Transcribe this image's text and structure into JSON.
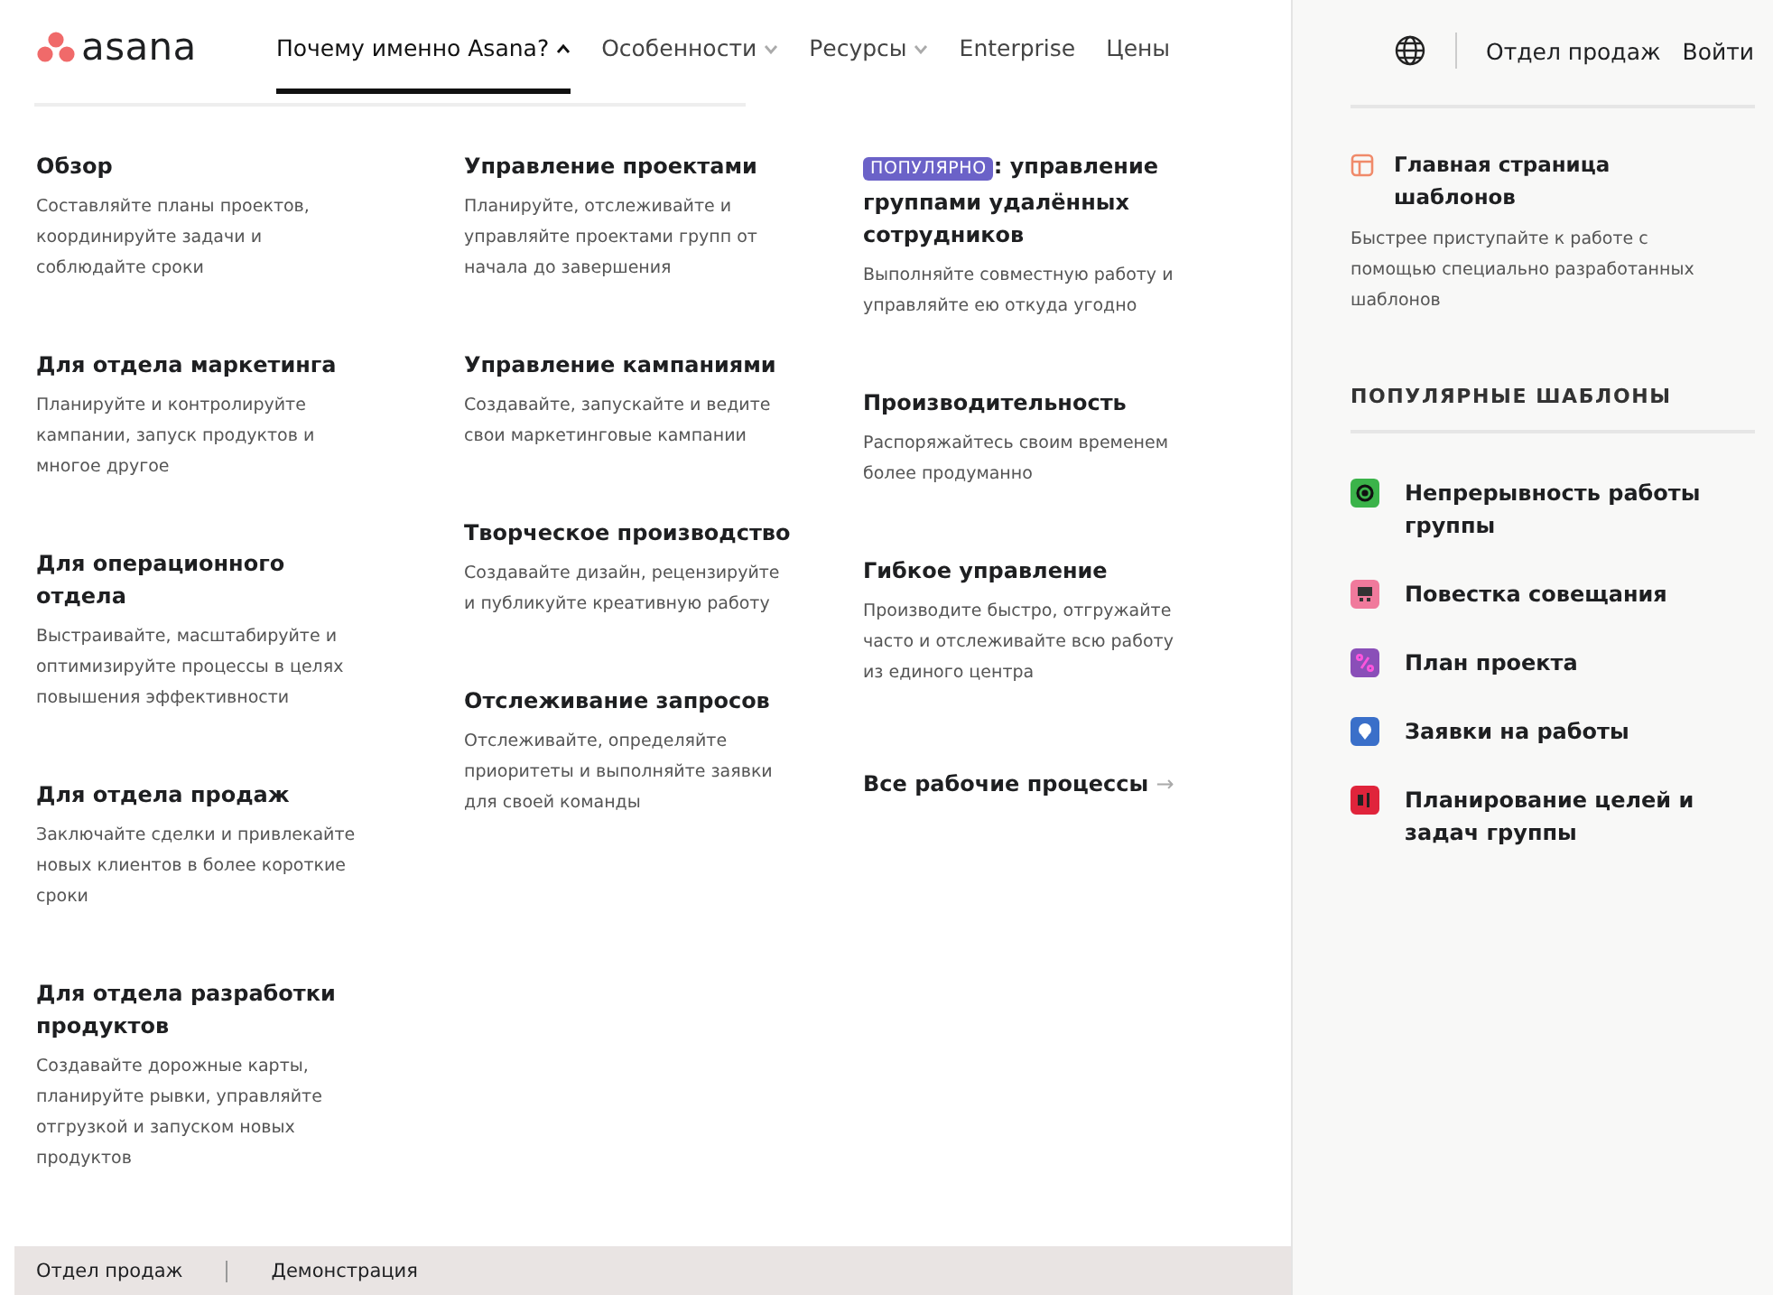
{
  "logo": {
    "text": "asana"
  },
  "nav": [
    {
      "label": "Почему именно Asana?",
      "dropdown": true,
      "expanded": true,
      "selected": true
    },
    {
      "label": "Особенности",
      "dropdown": true,
      "expanded": false,
      "selected": false
    },
    {
      "label": "Ресурсы",
      "dropdown": true,
      "expanded": false,
      "selected": false
    },
    {
      "label": "Enterprise",
      "dropdown": false,
      "selected": false
    },
    {
      "label": "Цены",
      "dropdown": false,
      "selected": false
    }
  ],
  "header_right": {
    "sales": "Отдел продаж",
    "login": "Войти"
  },
  "columns": [
    {
      "items": [
        {
          "title": "Обзор",
          "description": "Составляйте планы проектов, координируйте задачи и соблюдайте сроки"
        },
        {
          "title": "Для отдела маркетинга",
          "description": "Планируйте и контролируйте кампании, запуск продуктов и многое другое"
        },
        {
          "title": "Для операционного отдела",
          "description": "Выстраивайте, масштабируйте и оптимизируйте процессы в целях повышения эффективности"
        },
        {
          "title": "Для отдела продаж",
          "description": "Заключайте сделки и привлекайте новых клиентов в более короткие сроки"
        },
        {
          "title": "Для отдела разработки продуктов",
          "description": "Создавайте дорожные карты, планируйте рывки, управляйте отгрузкой и запуском новых продуктов"
        }
      ]
    },
    {
      "items": [
        {
          "title": "Управление проектами",
          "description": "Планируйте, отслеживайте и управляйте проектами групп от начала до завершения"
        },
        {
          "title": "Управление кампаниями",
          "description": "Создавайте, запускайте и ведите свои маркетинговые кампании"
        },
        {
          "title": "Творческое производство",
          "description": "Создавайте дизайн, рецензируйте и публикуйте креативную работу"
        },
        {
          "title": "Отслеживание запросов",
          "description": "Отслеживайте, определяйте приоритеты и выполняйте заявки для своей команды"
        }
      ]
    },
    {
      "items": [
        {
          "badge": "ПОПУЛЯРНО",
          "title": ": управление группами удалённых сотрудников",
          "description": "Выполняйте совместную работу и управляйте ею откуда угодно"
        },
        {
          "title": "Производительность",
          "description": "Распоряжайтесь своим временем более продуманно"
        },
        {
          "title": "Гибкое управление",
          "description": "Производите быстро, отгружайте часто и отслеживайте всю работу из единого центра"
        }
      ],
      "link": {
        "label": "Все рабочие процессы",
        "arrow": "→"
      }
    }
  ],
  "templates_home": {
    "title": "Главная страница шаблонов",
    "description": "Быстрее приступайте к работе с помощью специально разработанных шаблонов"
  },
  "popular_templates": {
    "heading": "ПОПУЛЯРНЫЕ ШАБЛОНЫ",
    "items": [
      {
        "name": "Непрерывность работы группы",
        "color": "#3bb34a",
        "kind": "target"
      },
      {
        "name": "Повестка совещания",
        "color": "#f07a9c",
        "kind": "board"
      },
      {
        "name": "План проекта",
        "color": "#8a4fb8",
        "kind": "path"
      },
      {
        "name": "Заявки на работы",
        "color": "#3a6fc9",
        "kind": "pin"
      },
      {
        "name": "Планирование целей и задач группы",
        "color": "#e0243b",
        "kind": "flag"
      }
    ]
  },
  "footer_bar": [
    "Отдел продаж",
    "Демонстрация"
  ]
}
